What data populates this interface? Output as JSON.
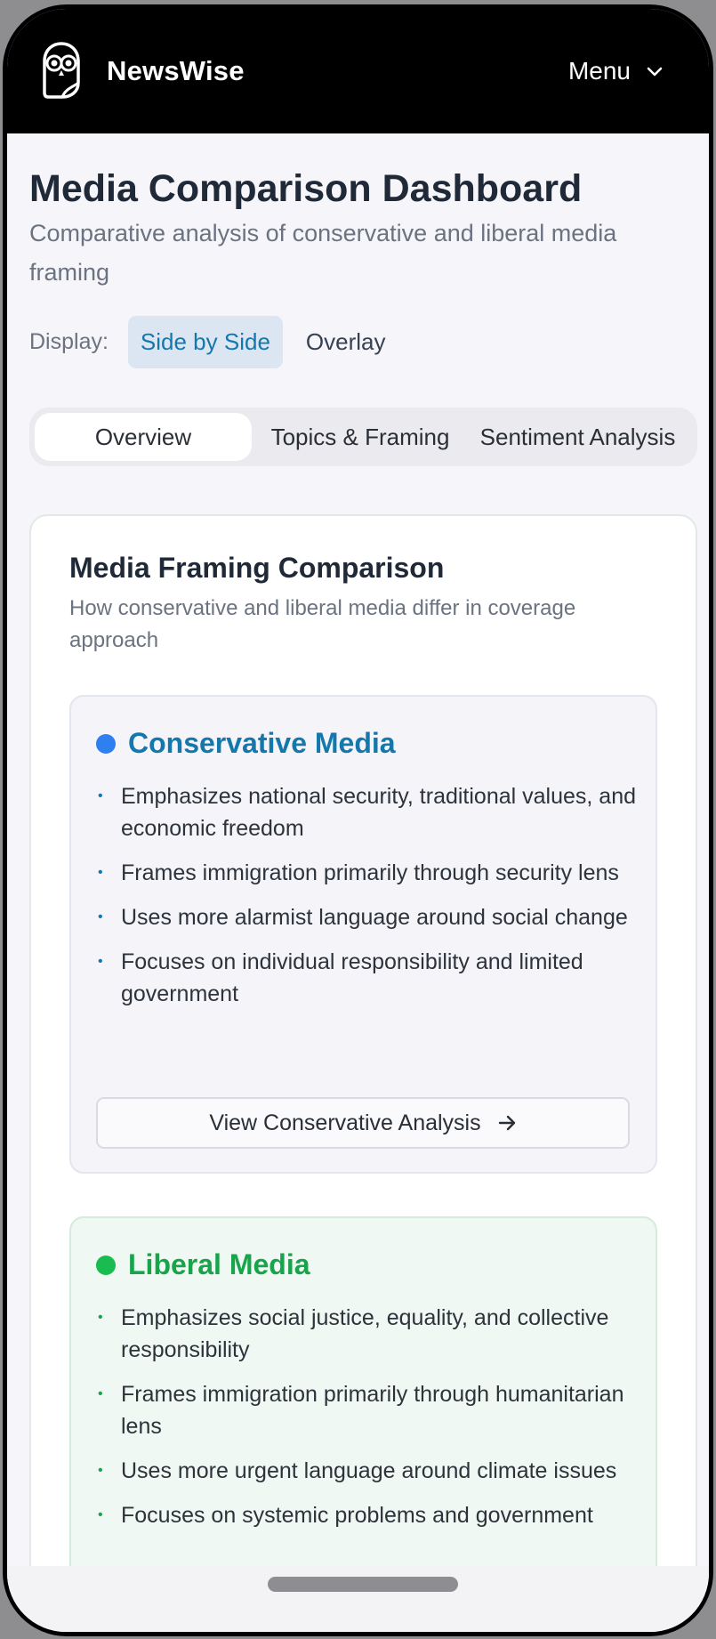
{
  "header": {
    "brand": "NewsWise",
    "menu_label": "Menu"
  },
  "page": {
    "title": "Media Comparison Dashboard",
    "subtitle": "Comparative analysis of conservative and liberal media framing"
  },
  "display": {
    "label": "Display:",
    "options": [
      "Side by Side",
      "Overlay"
    ],
    "selected": "Side by Side"
  },
  "tabs": [
    {
      "label": "Overview",
      "active": true
    },
    {
      "label": "Topics & Framing",
      "active": false
    },
    {
      "label": "Sentiment Analysis",
      "active": false
    }
  ],
  "card": {
    "title": "Media Framing Comparison",
    "subtitle": "How conservative and liberal media differ in coverage approach"
  },
  "conservative": {
    "name": "Conservative Media",
    "color": "#1478ad",
    "dot_color": "#2f7ff0",
    "points": [
      "Emphasizes national security, traditional values, and economic freedom",
      "Frames immigration primarily through security lens",
      "Uses more alarmist language around social change",
      "Focuses on individual responsibility and limited government"
    ],
    "button": "View Conservative Analysis"
  },
  "liberal": {
    "name": "Liberal Media",
    "color": "#17a44a",
    "dot_color": "#19bd4f",
    "points": [
      "Emphasizes social justice, equality, and collective responsibility",
      "Frames immigration primarily through humanitarian lens",
      "Uses more urgent language around climate issues",
      "Focuses on systemic problems and government"
    ]
  }
}
